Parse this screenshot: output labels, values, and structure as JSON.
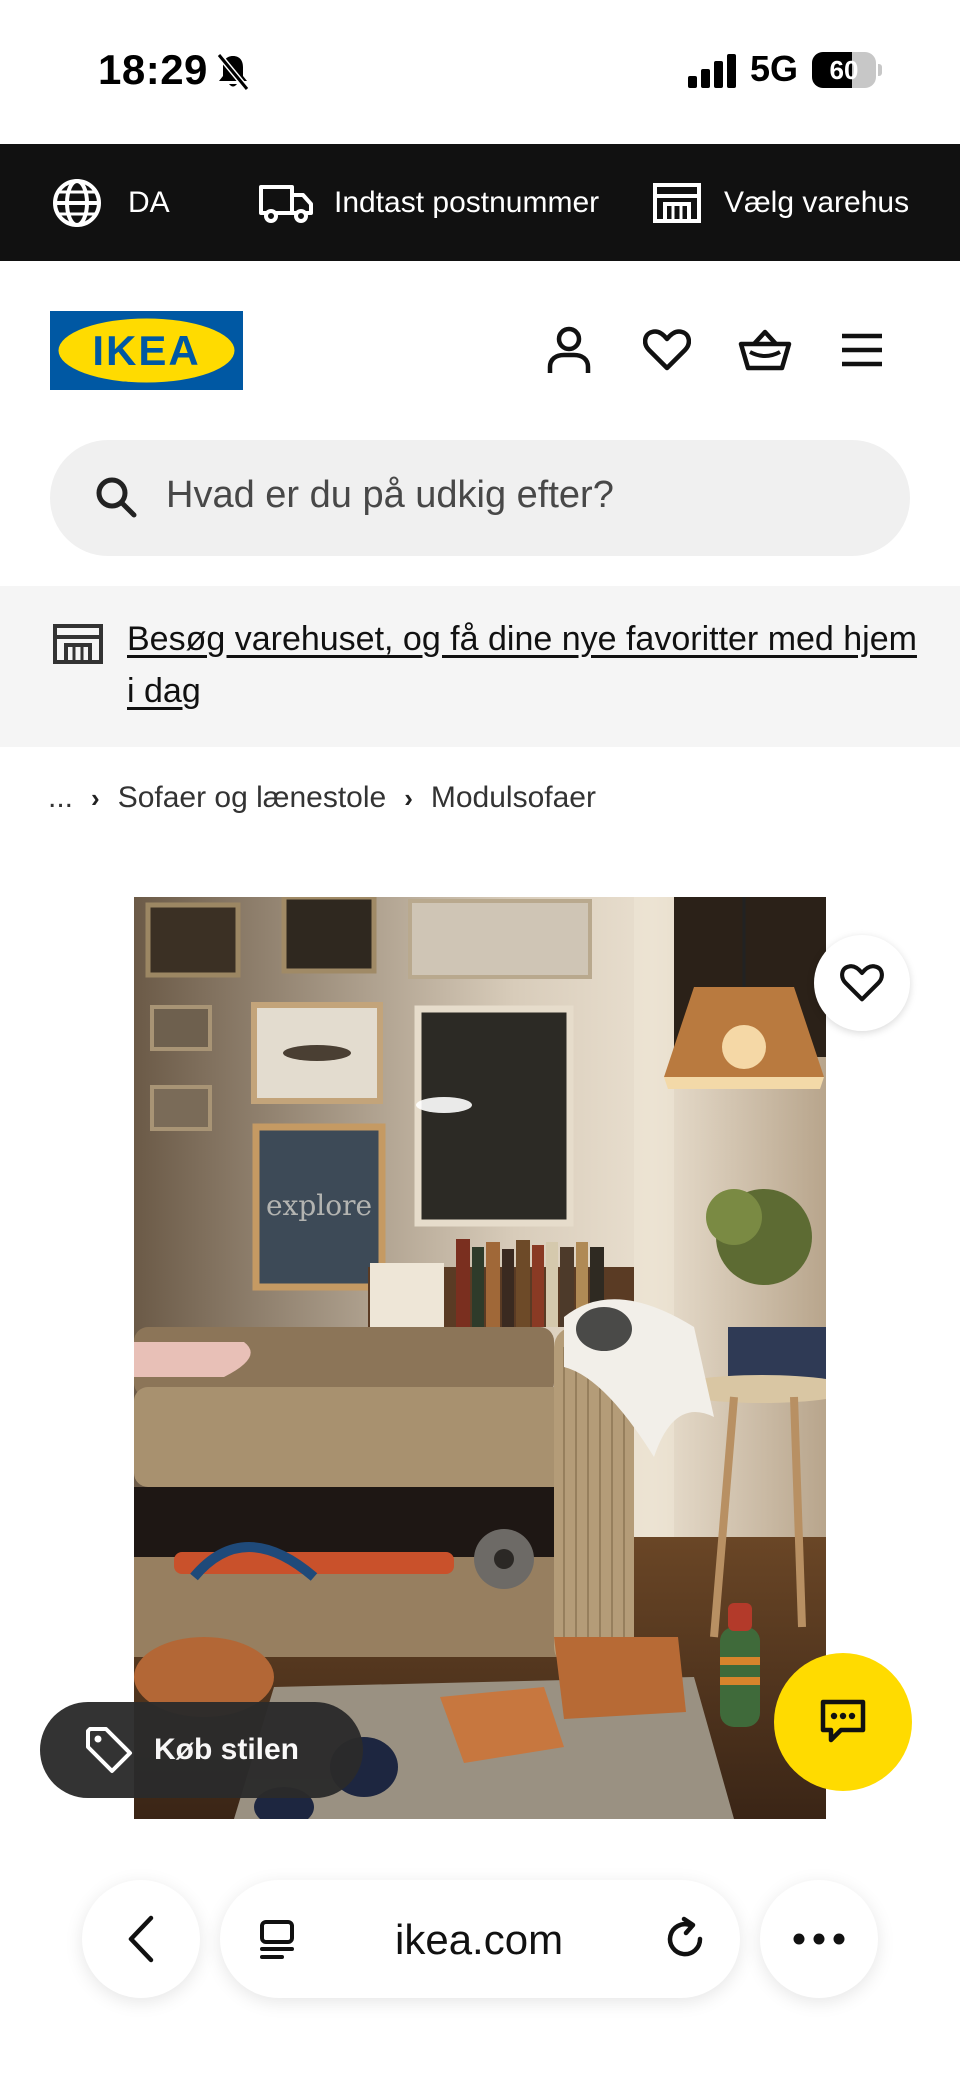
{
  "status_bar": {
    "time": "18:29",
    "network": "5G",
    "battery": "60"
  },
  "topbar": {
    "language": "DA",
    "postcode_label": "Indtast postnummer",
    "store_label": "Vælg varehus"
  },
  "header": {
    "logo_text": "IKEA",
    "icons": [
      "user-icon",
      "heart-icon",
      "basket-icon",
      "menu-icon"
    ]
  },
  "search": {
    "placeholder": "Hvad er du på udkig efter?"
  },
  "banner": {
    "text": "Besøg varehuset, og få dine nye favoritter med hjem i dag"
  },
  "breadcrumb": {
    "ellipsis": "...",
    "items": [
      "Sofaer og lænestole",
      "Modulsofaer"
    ]
  },
  "product": {
    "buy_style_label": "Køb stilen"
  },
  "browser": {
    "url": "ikea.com"
  },
  "colors": {
    "ikea_blue": "#0058a3",
    "ikea_yellow": "#ffdb00",
    "topbar_bg": "#111111"
  }
}
